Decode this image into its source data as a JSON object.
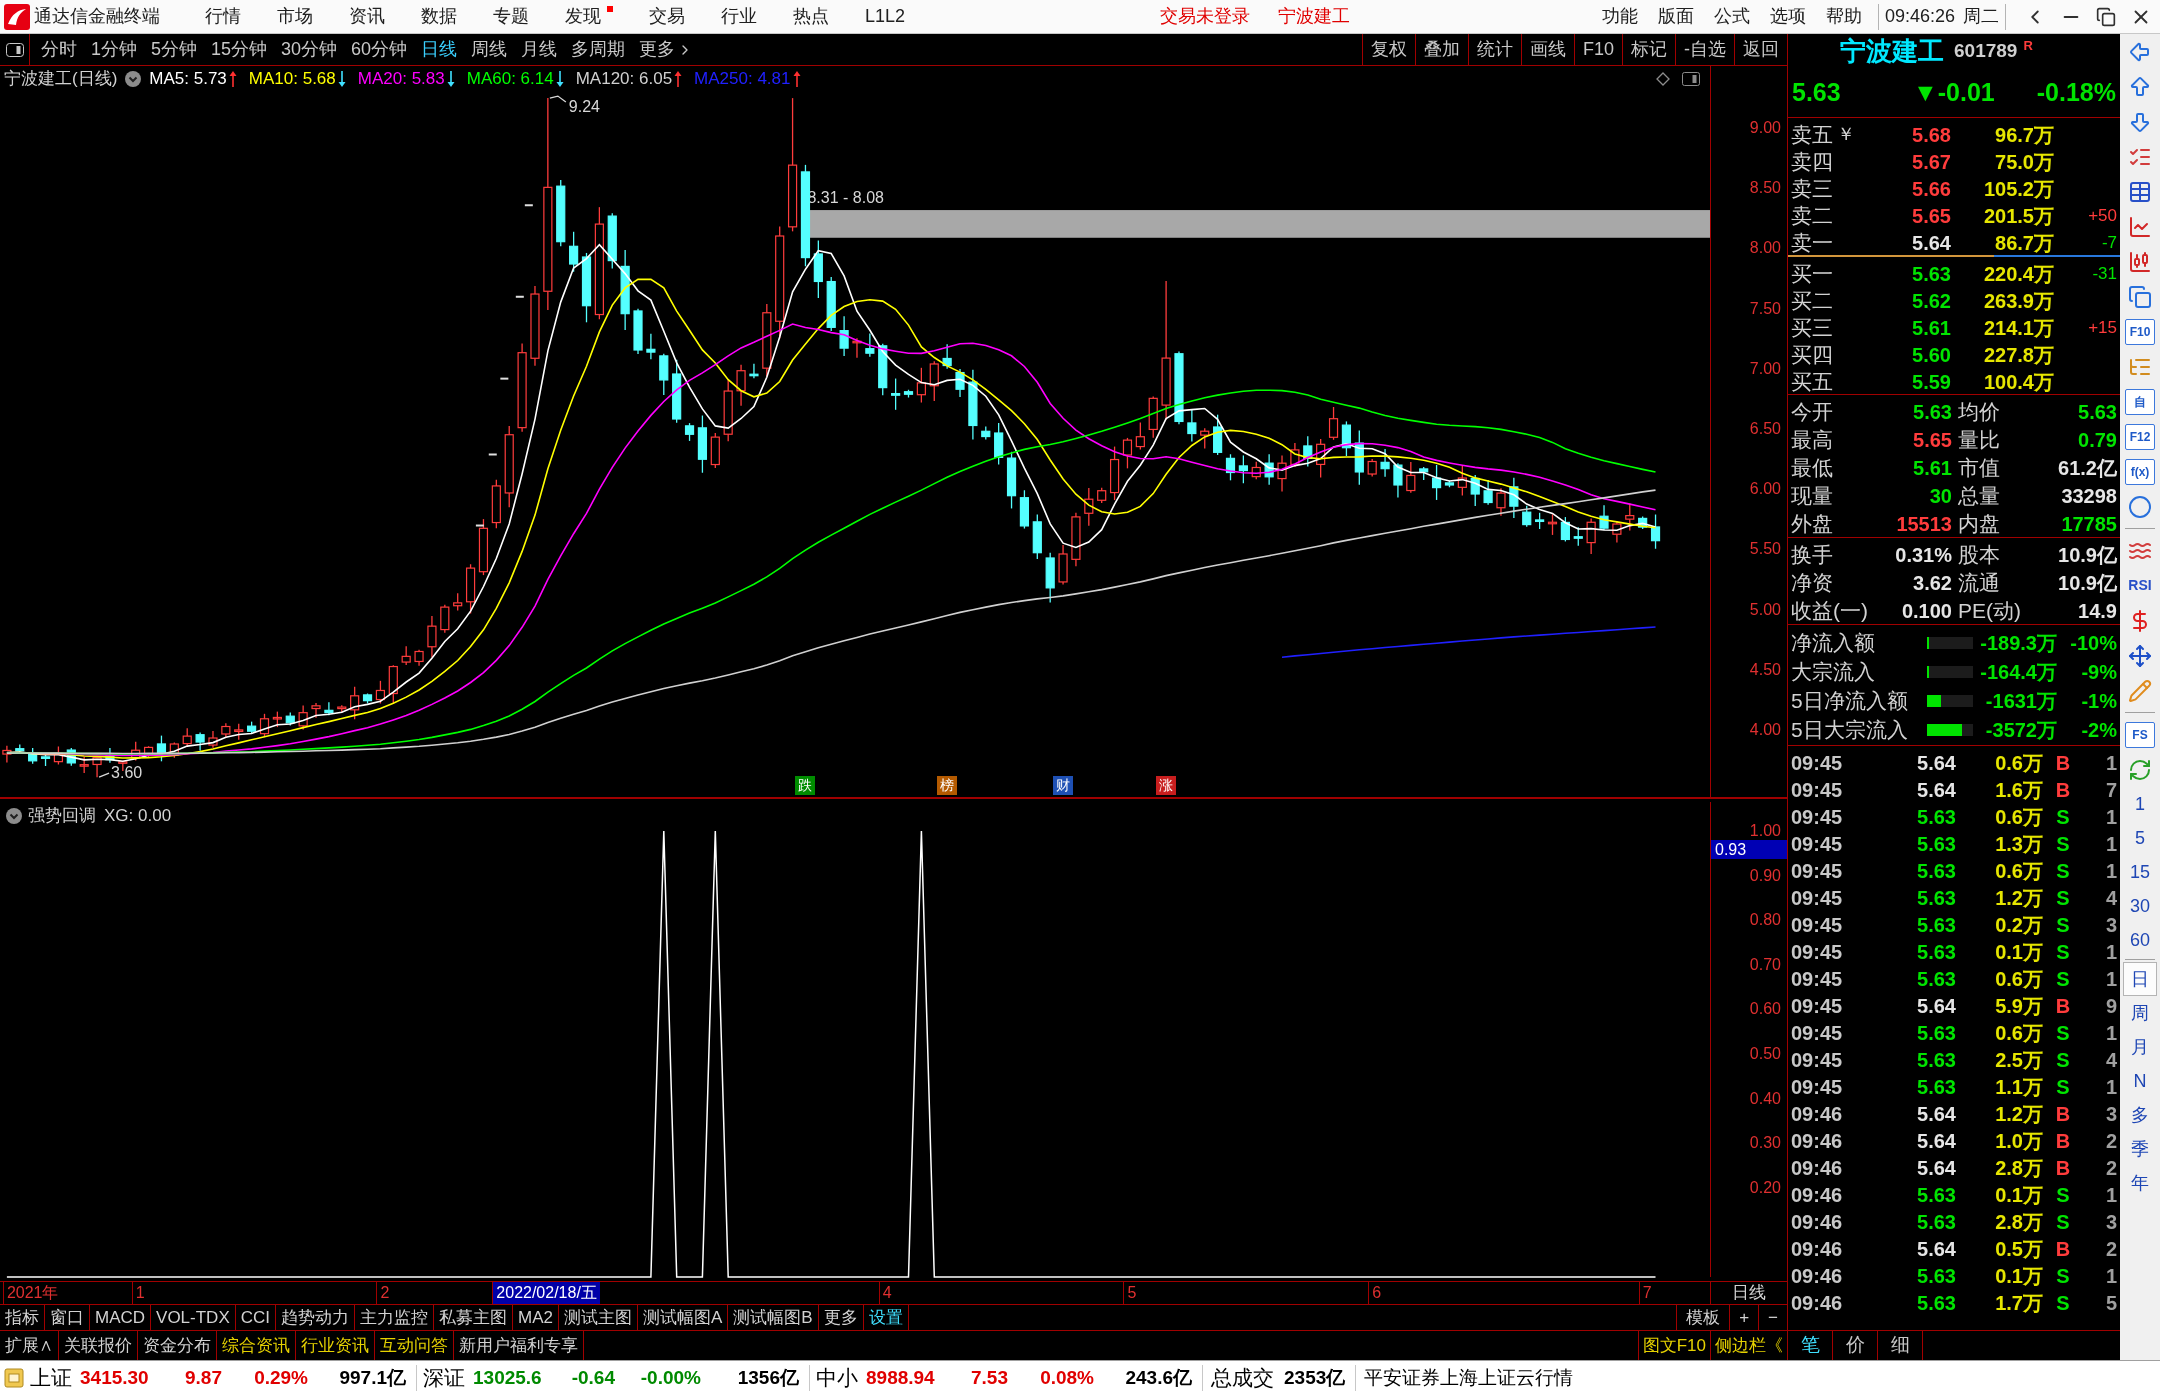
{
  "title_bar": {
    "app_name": "通达信金融终端",
    "menus": [
      {
        "label": "行情",
        "badge": false
      },
      {
        "label": "市场",
        "badge": false
      },
      {
        "label": "资讯",
        "badge": false
      },
      {
        "label": "数据",
        "badge": false
      },
      {
        "label": "专题",
        "badge": false
      },
      {
        "label": "发现",
        "badge": true
      },
      {
        "label": "交易",
        "badge": false
      },
      {
        "label": "行业",
        "badge": false
      },
      {
        "label": "热点",
        "badge": false
      },
      {
        "label": "L1L2",
        "badge": false
      }
    ],
    "login_status": "交易未登录",
    "stock_name": "宁波建工",
    "right_menus": [
      "功能",
      "版面",
      "公式",
      "选项",
      "帮助"
    ],
    "clock": "09:46:26",
    "weekday": "周二"
  },
  "period_tabs": [
    {
      "label": "分时",
      "selected": false
    },
    {
      "label": "1分钟",
      "selected": false
    },
    {
      "label": "5分钟",
      "selected": false
    },
    {
      "label": "15分钟",
      "selected": false
    },
    {
      "label": "30分钟",
      "selected": false
    },
    {
      "label": "60分钟",
      "selected": false
    },
    {
      "label": "日线",
      "selected": true
    },
    {
      "label": "周线",
      "selected": false
    },
    {
      "label": "月线",
      "selected": false
    },
    {
      "label": "多周期",
      "selected": false
    },
    {
      "label": "更多",
      "selected": false
    }
  ],
  "chart_tools": [
    "复权",
    "叠加",
    "统计",
    "画线",
    "F10",
    "标记",
    "-自选",
    "返回"
  ],
  "main_chart": {
    "title": "宁波建工(日线)",
    "legend": [
      {
        "label": "MA5: 5.73",
        "color": "#ffffff",
        "rising": true
      },
      {
        "label": "MA10: 5.68",
        "color": "#ffff00",
        "rising": false
      },
      {
        "label": "MA20: 5.83",
        "color": "#ff00ff",
        "rising": false
      },
      {
        "label": "MA60: 6.14",
        "color": "#00ff00",
        "rising": false
      },
      {
        "label": "MA120: 6.05",
        "color": "#d0d0d0",
        "rising": true
      },
      {
        "label": "MA250: 4.81",
        "color": "#2020ff",
        "rising": true
      }
    ],
    "high_label": "9.24",
    "low_label": "3.60",
    "gap_label": "8.31 - 8.08",
    "events": [
      {
        "label": "跌",
        "color": "#008c00"
      },
      {
        "label": "榜",
        "color": "#b45a00"
      },
      {
        "label": "财",
        "color": "#1e50b4"
      },
      {
        "label": "涨",
        "color": "#c81e1e"
      }
    ],
    "price_ticks": [
      "9.00",
      "8.50",
      "8.00",
      "7.50",
      "7.00",
      "6.50",
      "6.00",
      "5.50",
      "5.00",
      "4.50",
      "4.00"
    ]
  },
  "indicator_chart": {
    "title": "强势回调",
    "reading": "XG: 0.00",
    "cursor_value": "0.93",
    "chart_data": {
      "type": "line",
      "ylim": [
        0,
        1.065
      ],
      "yticks": [
        {
          "value": 0.2,
          "label": "0.20"
        },
        {
          "value": 0.3,
          "label": "0.30"
        },
        {
          "value": 0.4,
          "label": "0.40"
        },
        {
          "value": 0.5,
          "label": "0.50"
        },
        {
          "value": 0.6,
          "label": "0.60"
        },
        {
          "value": 0.7,
          "label": "0.70"
        },
        {
          "value": 0.8,
          "label": "0.80"
        },
        {
          "value": 0.9,
          "label": "0.90"
        },
        {
          "value": 1.0,
          "label": "1.00"
        }
      ],
      "series": [
        {
          "color": "#ffffff",
          "values": [
            0,
            0,
            0,
            0,
            0,
            0,
            0,
            0,
            0,
            0,
            0,
            0,
            0,
            0,
            0,
            0,
            0,
            0,
            0,
            0,
            0,
            0,
            0,
            0,
            0,
            0,
            0,
            0,
            0,
            0,
            0,
            0,
            0,
            0,
            0,
            0,
            0,
            0,
            0,
            0,
            0,
            0,
            0,
            0,
            0,
            0,
            0,
            0,
            0,
            0,
            0,
            1,
            0,
            0,
            0,
            1,
            0,
            0,
            0,
            0,
            0,
            0,
            0,
            0,
            0,
            0,
            0,
            0,
            0,
            0,
            0,
            1,
            0,
            0,
            0,
            0,
            0,
            0,
            0,
            0,
            0,
            0,
            0,
            0,
            0,
            0,
            0,
            0,
            0,
            0,
            0,
            0,
            0,
            0,
            0,
            0,
            0,
            0,
            0,
            0,
            0,
            0,
            0,
            0,
            0,
            0,
            0,
            0,
            0,
            0,
            0,
            0,
            0,
            0,
            0,
            0,
            0,
            0,
            0,
            0,
            0,
            0,
            0,
            0,
            0,
            0,
            0,
            0,
            0
          ]
        }
      ]
    }
  },
  "date_axis": {
    "labels": [
      {
        "label": "2021年",
        "selected": false
      },
      {
        "label": "1",
        "selected": false
      },
      {
        "label": "2",
        "selected": false
      },
      {
        "label": "2022/02/18/五",
        "selected": true
      },
      {
        "label": "4",
        "selected": false
      },
      {
        "label": "5",
        "selected": false
      },
      {
        "label": "6",
        "selected": false
      },
      {
        "label": "7",
        "selected": false
      }
    ],
    "period": "日线"
  },
  "indicator_tabs": [
    {
      "label": "指标",
      "kind": "tab"
    },
    {
      "label": "窗口",
      "kind": "tab"
    },
    {
      "label": "MACD",
      "kind": "tab"
    },
    {
      "label": "VOL-TDX",
      "kind": "tab"
    },
    {
      "label": "CCI",
      "kind": "tab"
    },
    {
      "label": "趋势动力",
      "kind": "tab"
    },
    {
      "label": "主力监控",
      "kind": "tab"
    },
    {
      "label": "私募主图",
      "kind": "tab"
    },
    {
      "label": "MA2",
      "kind": "tab"
    },
    {
      "label": "测试主图",
      "kind": "tab"
    },
    {
      "label": "测试幅图A",
      "kind": "tab"
    },
    {
      "label": "测试幅图B",
      "kind": "tab"
    },
    {
      "label": "更多",
      "kind": "tab"
    },
    {
      "label": "设置",
      "kind": "setting"
    }
  ],
  "template_controls": [
    "模板",
    "+",
    "−"
  ],
  "info_tabs": [
    {
      "label": "扩展∧",
      "kind": "tab"
    },
    {
      "label": "关联报价",
      "kind": "tab"
    },
    {
      "label": "资金分布",
      "kind": "tab"
    },
    {
      "label": "综合资讯",
      "kind": "news"
    },
    {
      "label": "行业资讯",
      "kind": "news"
    },
    {
      "label": "互动问答",
      "kind": "news"
    },
    {
      "label": "新用户福利专享",
      "kind": "tab"
    }
  ],
  "info_links": [
    "图文F10",
    "侧边栏《"
  ],
  "quote": {
    "name": "宁波建工",
    "code": "601789",
    "badge": "R",
    "price": "5.63",
    "change": "▼-0.01",
    "percent": "-0.18%",
    "color": "#00e400",
    "asks": [
      {
        "label": "卖五",
        "note": "￥",
        "price": "5.68",
        "color": "#ff3c3c",
        "volume": "96.7万"
      },
      {
        "label": "卖四",
        "price": "5.67",
        "color": "#ff3c3c",
        "volume": "75.0万"
      },
      {
        "label": "卖三",
        "price": "5.66",
        "color": "#ff3c3c",
        "volume": "105.2万"
      },
      {
        "label": "卖二",
        "price": "5.65",
        "color": "#ff3c3c",
        "volume": "201.5万",
        "delta": {
          "text": "+50",
          "color": "#ff3c3c"
        }
      },
      {
        "label": "卖一",
        "price": "5.64",
        "color": "#e6e6e6",
        "volume": "86.7万",
        "delta": {
          "text": "-7",
          "color": "#00e400"
        }
      }
    ],
    "depth_ratio": {
      "level": 0.62
    },
    "bids": [
      {
        "label": "买一",
        "price": "5.63",
        "color": "#00e400",
        "volume": "220.4万",
        "delta": {
          "text": "-31",
          "color": "#00e400"
        }
      },
      {
        "label": "买二",
        "price": "5.62",
        "color": "#00e400",
        "volume": "263.9万"
      },
      {
        "label": "买三",
        "price": "5.61",
        "color": "#00e400",
        "volume": "214.1万",
        "delta": {
          "text": "+15",
          "color": "#ff3c3c"
        }
      },
      {
        "label": "买四",
        "price": "5.60",
        "color": "#00e400",
        "volume": "227.8万"
      },
      {
        "label": "买五",
        "price": "5.59",
        "color": "#00e400",
        "volume": "100.4万"
      }
    ],
    "stats": [
      [
        {
          "label": "今开",
          "value": "5.63",
          "color": "#00e400"
        },
        {
          "label": "均价",
          "value": "5.63",
          "color": "#00e400"
        }
      ],
      [
        {
          "label": "最高",
          "value": "5.65",
          "color": "#ff3c3c"
        },
        {
          "label": "量比",
          "value": "0.79",
          "color": "#00e400"
        }
      ],
      [
        {
          "label": "最低",
          "value": "5.61",
          "color": "#00e400"
        },
        {
          "label": "市值",
          "value": "61.2亿",
          "color": "#e6e6e6"
        }
      ],
      [
        {
          "label": "现量",
          "value": "30",
          "color": "#00e400"
        },
        {
          "label": "总量",
          "value": "33298",
          "color": "#e6e6e6"
        }
      ],
      [
        {
          "label": "外盘",
          "value": "15513",
          "color": "#ff3c3c"
        },
        {
          "label": "内盘",
          "value": "17785",
          "color": "#00e400"
        }
      ]
    ],
    "fundamentals": [
      [
        {
          "label": "换手",
          "value": "0.31%"
        },
        {
          "label": "股本",
          "value": "10.9亿"
        }
      ],
      [
        {
          "label": "净资",
          "value": "3.62"
        },
        {
          "label": "流通",
          "value": "10.9亿"
        }
      ],
      [
        {
          "label": "收益(一)",
          "value": "0.100"
        },
        {
          "label": "PE(动)",
          "value": "14.9"
        }
      ]
    ],
    "flows": [
      {
        "label": "净流入额",
        "level": 0.04,
        "value": "-189.3万",
        "percent": "-10%"
      },
      {
        "label": "大宗流入",
        "level": 0.04,
        "value": "-164.4万",
        "percent": "-9%"
      },
      {
        "label": "5日净流入额",
        "level": 0.3,
        "value": "-1631万",
        "percent": "-1%"
      },
      {
        "label": "5日大宗流入",
        "level": 0.76,
        "value": "-3572万",
        "percent": "-2%"
      }
    ],
    "trades": [
      {
        "time": "09:45",
        "price": "5.64",
        "color": "#e6e6e6",
        "volume": "0.6万",
        "side": "B",
        "kind": "buy",
        "count": "1"
      },
      {
        "time": "09:45",
        "price": "5.64",
        "color": "#e6e6e6",
        "volume": "1.6万",
        "side": "B",
        "kind": "buy",
        "count": "7"
      },
      {
        "time": "09:45",
        "price": "5.63",
        "color": "#00e400",
        "volume": "0.6万",
        "side": "S",
        "kind": "sell",
        "count": "1"
      },
      {
        "time": "09:45",
        "price": "5.63",
        "color": "#00e400",
        "volume": "1.3万",
        "side": "S",
        "kind": "sell",
        "count": "1"
      },
      {
        "time": "09:45",
        "price": "5.63",
        "color": "#00e400",
        "volume": "0.6万",
        "side": "S",
        "kind": "sell",
        "count": "1"
      },
      {
        "time": "09:45",
        "price": "5.63",
        "color": "#00e400",
        "volume": "1.2万",
        "side": "S",
        "kind": "sell",
        "count": "4"
      },
      {
        "time": "09:45",
        "price": "5.63",
        "color": "#00e400",
        "volume": "0.2万",
        "side": "S",
        "kind": "sell",
        "count": "3"
      },
      {
        "time": "09:45",
        "price": "5.63",
        "color": "#00e400",
        "volume": "0.1万",
        "side": "S",
        "kind": "sell",
        "count": "1"
      },
      {
        "time": "09:45",
        "price": "5.63",
        "color": "#00e400",
        "volume": "0.6万",
        "side": "S",
        "kind": "sell",
        "count": "1"
      },
      {
        "time": "09:45",
        "price": "5.64",
        "color": "#e6e6e6",
        "volume": "5.9万",
        "side": "B",
        "kind": "buy",
        "count": "9"
      },
      {
        "time": "09:45",
        "price": "5.63",
        "color": "#00e400",
        "volume": "0.6万",
        "side": "S",
        "kind": "sell",
        "count": "1"
      },
      {
        "time": "09:45",
        "price": "5.63",
        "color": "#00e400",
        "volume": "2.5万",
        "side": "S",
        "kind": "sell",
        "count": "4"
      },
      {
        "time": "09:45",
        "price": "5.63",
        "color": "#00e400",
        "volume": "1.1万",
        "side": "S",
        "kind": "sell",
        "count": "1"
      },
      {
        "time": "09:46",
        "price": "5.64",
        "color": "#e6e6e6",
        "volume": "1.2万",
        "side": "B",
        "kind": "buy",
        "count": "3"
      },
      {
        "time": "09:46",
        "price": "5.64",
        "color": "#e6e6e6",
        "volume": "1.0万",
        "side": "B",
        "kind": "buy",
        "count": "2"
      },
      {
        "time": "09:46",
        "price": "5.64",
        "color": "#e6e6e6",
        "volume": "2.8万",
        "side": "B",
        "kind": "buy",
        "count": "2"
      },
      {
        "time": "09:46",
        "price": "5.63",
        "color": "#00e400",
        "volume": "0.1万",
        "side": "S",
        "kind": "sell",
        "count": "1"
      },
      {
        "time": "09:46",
        "price": "5.63",
        "color": "#00e400",
        "volume": "2.8万",
        "side": "S",
        "kind": "sell",
        "count": "3"
      },
      {
        "time": "09:46",
        "price": "5.64",
        "color": "#e6e6e6",
        "volume": "0.5万",
        "side": "B",
        "kind": "buy",
        "count": "2"
      },
      {
        "time": "09:46",
        "price": "5.63",
        "color": "#00e400",
        "volume": "0.1万",
        "side": "S",
        "kind": "sell",
        "count": "1"
      },
      {
        "time": "09:46",
        "price": "5.63",
        "color": "#00e400",
        "volume": "1.7万",
        "side": "S",
        "kind": "sell",
        "count": "5"
      }
    ]
  },
  "trade_tabs": [
    {
      "label": "笔",
      "selected": true
    },
    {
      "label": "价",
      "selected": false
    },
    {
      "label": "细",
      "selected": false
    }
  ],
  "side_toolbar": {
    "tiles": [
      {
        "label": "F10",
        "kind": "tile"
      },
      {
        "label": "自",
        "kind": "tile"
      },
      {
        "label": "F12",
        "kind": "tile"
      },
      {
        "label": "f(x)",
        "kind": "tile"
      },
      {
        "label": "RSI",
        "kind": "text"
      },
      {
        "label": "FS",
        "kind": "tile"
      }
    ],
    "periods": [
      {
        "label": "1",
        "selected": false
      },
      {
        "label": "5",
        "selected": false
      },
      {
        "label": "15",
        "selected": false
      },
      {
        "label": "30",
        "selected": false
      },
      {
        "label": "60",
        "selected": false
      },
      {
        "label": "日",
        "selected": true
      },
      {
        "label": "周",
        "selected": false
      },
      {
        "label": "月",
        "selected": false
      },
      {
        "label": "N",
        "selected": false
      },
      {
        "label": "多",
        "selected": false
      },
      {
        "label": "季",
        "selected": false
      },
      {
        "label": "年",
        "selected": false
      }
    ]
  },
  "status_bar": {
    "indices": [
      {
        "name": "上证",
        "value": "3415.30",
        "change": "9.87",
        "percent": "0.29%",
        "amount": "997.1亿",
        "color": "#e00000"
      },
      {
        "name": "深证",
        "value": "13025.6",
        "change": "-0.64",
        "percent": "-0.00%",
        "amount": "1356亿",
        "color": "#008a00"
      },
      {
        "name": "中小",
        "value": "8988.94",
        "change": "7.53",
        "percent": "0.08%",
        "amount": "243.6亿",
        "color": "#e00000"
      }
    ],
    "total_label": "总成交",
    "total": "2353亿",
    "server": "平安证券上海上证云行情"
  }
}
